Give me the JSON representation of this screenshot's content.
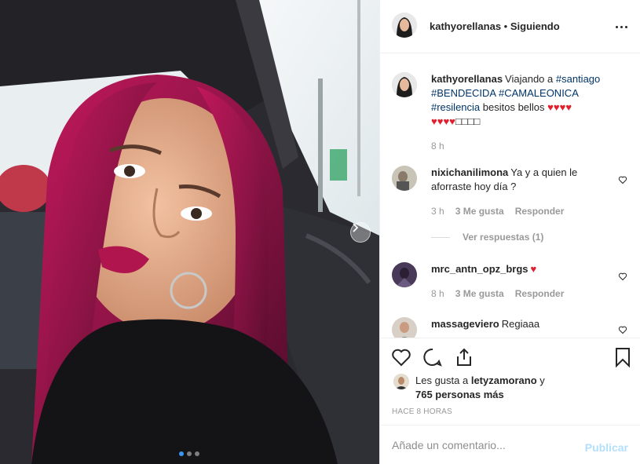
{
  "post": {
    "author": "kathyorellanas",
    "separator": "•",
    "follow_status": "Siguiendo",
    "carousel": {
      "slide_count": 3,
      "active_index": 0
    }
  },
  "caption": {
    "username": "kathyorellanas",
    "text_before": "Viajando a ",
    "tag1": "#santiago",
    "tag2": "#BENDECIDA",
    "tag3": "#CAMALEONICA",
    "tag4": "#resilencia",
    "text_after": " besitos bellos ",
    "hearts_line1": "♥♥♥♥",
    "hearts_line2": "♥♥♥♥",
    "emoji_tail": "□□□□",
    "time": "8 h"
  },
  "comments": [
    {
      "username": "nixichanilimona",
      "text": "Ya y a quien le aforraste hoy día ?",
      "time": "3 h",
      "likes": "3 Me gusta",
      "reply": "Responder",
      "view_replies": "Ver respuestas (1)"
    },
    {
      "username": "mrc_antn_opz_brgs",
      "text": "",
      "hearts": "♥",
      "time": "8 h",
      "likes": "3 Me gusta",
      "reply": "Responder"
    },
    {
      "username": "massageviero",
      "text": "Regiaaa"
    }
  ],
  "likes": {
    "prefix": "Les gusta a",
    "user": "letyzamorano",
    "conj": "y",
    "others": "765 personas más"
  },
  "timestamp": "HACE 8 HORAS",
  "comment_box": {
    "placeholder": "Añade un comentario...",
    "publish": "Publicar"
  },
  "colors": {
    "link": "#003569",
    "heart": "#e0202c",
    "publish_disabled": "#b2dffc",
    "carousel_active": "#3897f0"
  }
}
